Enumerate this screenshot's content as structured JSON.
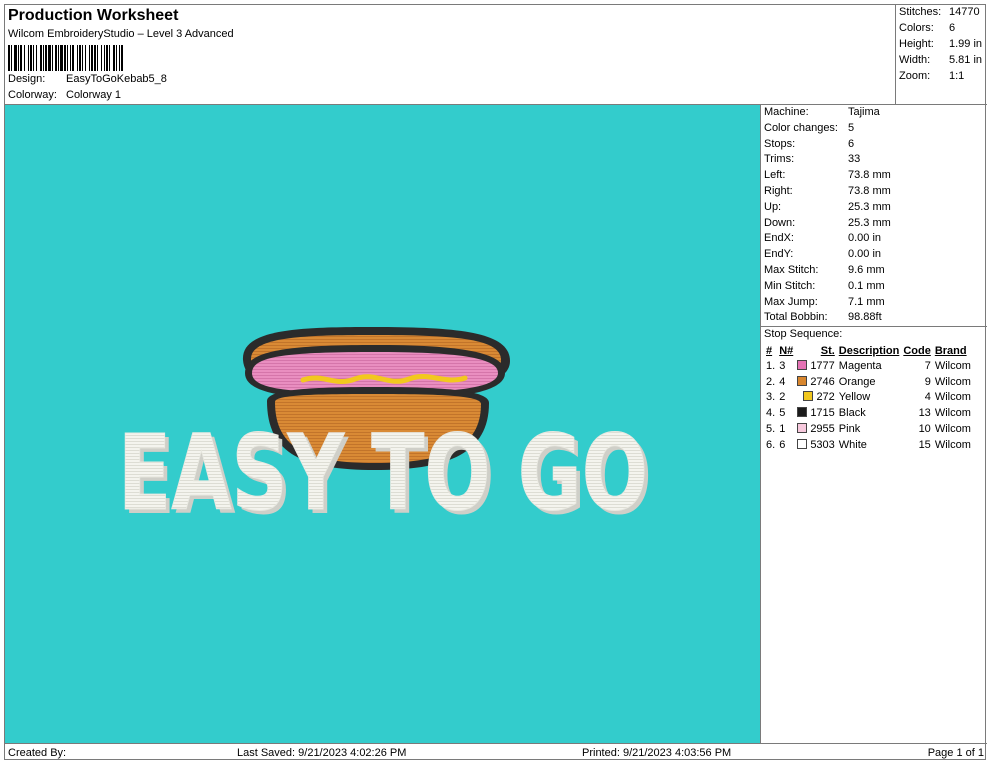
{
  "header": {
    "title": "Production Worksheet",
    "software": "Wilcom EmbroideryStudio – Level 3 Advanced",
    "design_label": "Design:",
    "design_value": "EasyToGoKebab5_8",
    "colorway_label": "Colorway:",
    "colorway_value": "Colorway 1"
  },
  "stats": {
    "stitches_label": "Stitches:",
    "stitches_value": "14770",
    "colors_label": "Colors:",
    "colors_value": "6",
    "height_label": "Height:",
    "height_value": "1.99 in",
    "width_label": "Width:",
    "width_value": "5.81 in",
    "zoom_label": "Zoom:",
    "zoom_value": "1:1"
  },
  "machine_info": [
    {
      "label": "Machine:",
      "value": "Tajima"
    },
    {
      "label": "Color changes:",
      "value": "5"
    },
    {
      "label": "Stops:",
      "value": "6"
    },
    {
      "label": "Trims:",
      "value": "33"
    },
    {
      "label": "Left:",
      "value": "73.8 mm"
    },
    {
      "label": "Right:",
      "value": "73.8 mm"
    },
    {
      "label": "Up:",
      "value": "25.3 mm"
    },
    {
      "label": "Down:",
      "value": "25.3 mm"
    },
    {
      "label": "EndX:",
      "value": "0.00 in"
    },
    {
      "label": "EndY:",
      "value": "0.00 in"
    },
    {
      "label": "Max Stitch:",
      "value": "9.6 mm"
    },
    {
      "label": "Min Stitch:",
      "value": "0.1 mm"
    },
    {
      "label": "Max Jump:",
      "value": "7.1 mm"
    },
    {
      "label": "Total Bobbin:",
      "value": "98.88ft"
    }
  ],
  "stop_sequence": {
    "title": "Stop Sequence:",
    "headers": [
      "#",
      "N#",
      "St.",
      "Description",
      "Code",
      "Brand"
    ],
    "rows": [
      {
        "num": "1.",
        "n": "3",
        "color": "#e472b4",
        "st": "1777",
        "desc": "Magenta",
        "code": "7",
        "brand": "Wilcom"
      },
      {
        "num": "2.",
        "n": "4",
        "color": "#d8862e",
        "st": "2746",
        "desc": "Orange",
        "code": "9",
        "brand": "Wilcom"
      },
      {
        "num": "3.",
        "n": "2",
        "color": "#f2c81e",
        "st": "272",
        "desc": "Yellow",
        "code": "4",
        "brand": "Wilcom"
      },
      {
        "num": "4.",
        "n": "5",
        "color": "#1a1a1a",
        "st": "1715",
        "desc": "Black",
        "code": "13",
        "brand": "Wilcom"
      },
      {
        "num": "5.",
        "n": "1",
        "color": "#f7c9dd",
        "st": "2955",
        "desc": "Pink",
        "code": "10",
        "brand": "Wilcom"
      },
      {
        "num": "6.",
        "n": "6",
        "color": "#ffffff",
        "st": "5303",
        "desc": "White",
        "code": "15",
        "brand": "Wilcom"
      }
    ]
  },
  "design_artwork": {
    "text": "EASY TO GO",
    "background_color": "#33cccc"
  },
  "footer": {
    "created_by": "Created By:",
    "last_saved": "Last Saved: 9/21/2023 4:02:26 PM",
    "printed": "Printed: 9/21/2023 4:03:56 PM",
    "page": "Page 1 of 1"
  }
}
